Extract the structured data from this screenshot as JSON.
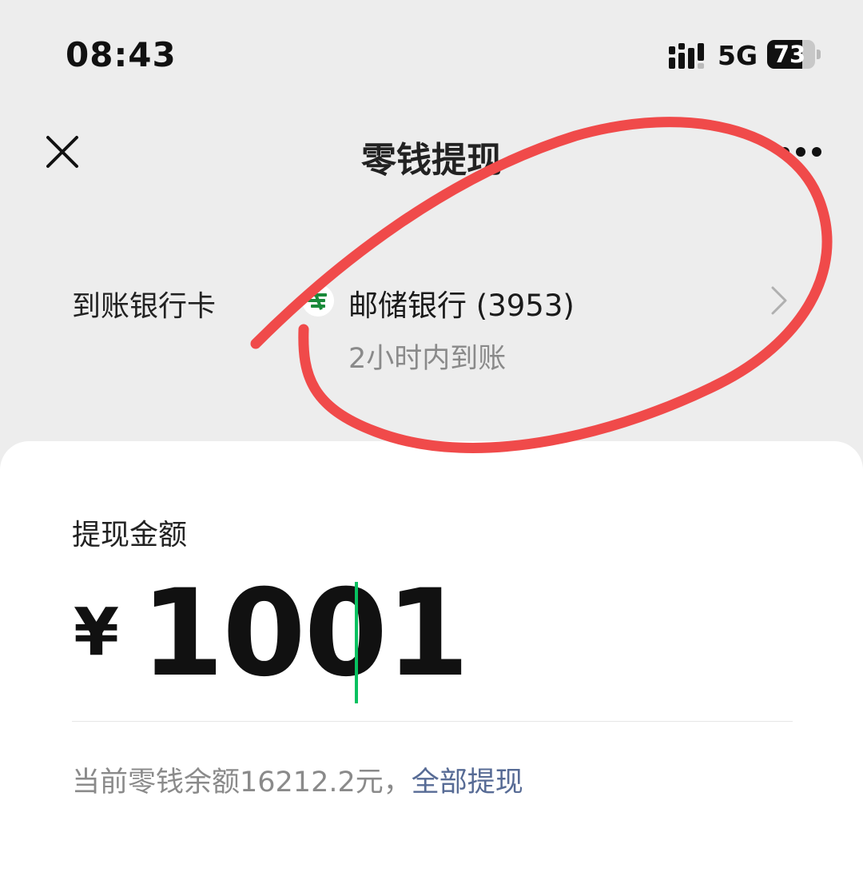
{
  "status_bar": {
    "time": "08:43",
    "network": "5G",
    "battery": "73",
    "battery_level": 0.73
  },
  "nav": {
    "title": "零钱提现",
    "close_icon": "close-icon",
    "more_icon": "more-icon"
  },
  "bank": {
    "label": "到账银行卡",
    "name": "邮储银行 (3953)",
    "arrival": "2小时内到账",
    "logo_icon": "postal-bank-logo-icon",
    "chevron_icon": "chevron-right-icon"
  },
  "withdraw": {
    "label": "提现金额",
    "currency": "¥",
    "amount": "1001",
    "balance_text": "当前零钱余额16212.2元，",
    "withdraw_all": "全部提现"
  },
  "colors": {
    "background": "#ededed",
    "card": "#ffffff",
    "accent_green": "#07c160",
    "link_blue": "#576b95",
    "annotation_red": "#f04a4a",
    "logo_green": "#1a8a3a"
  }
}
